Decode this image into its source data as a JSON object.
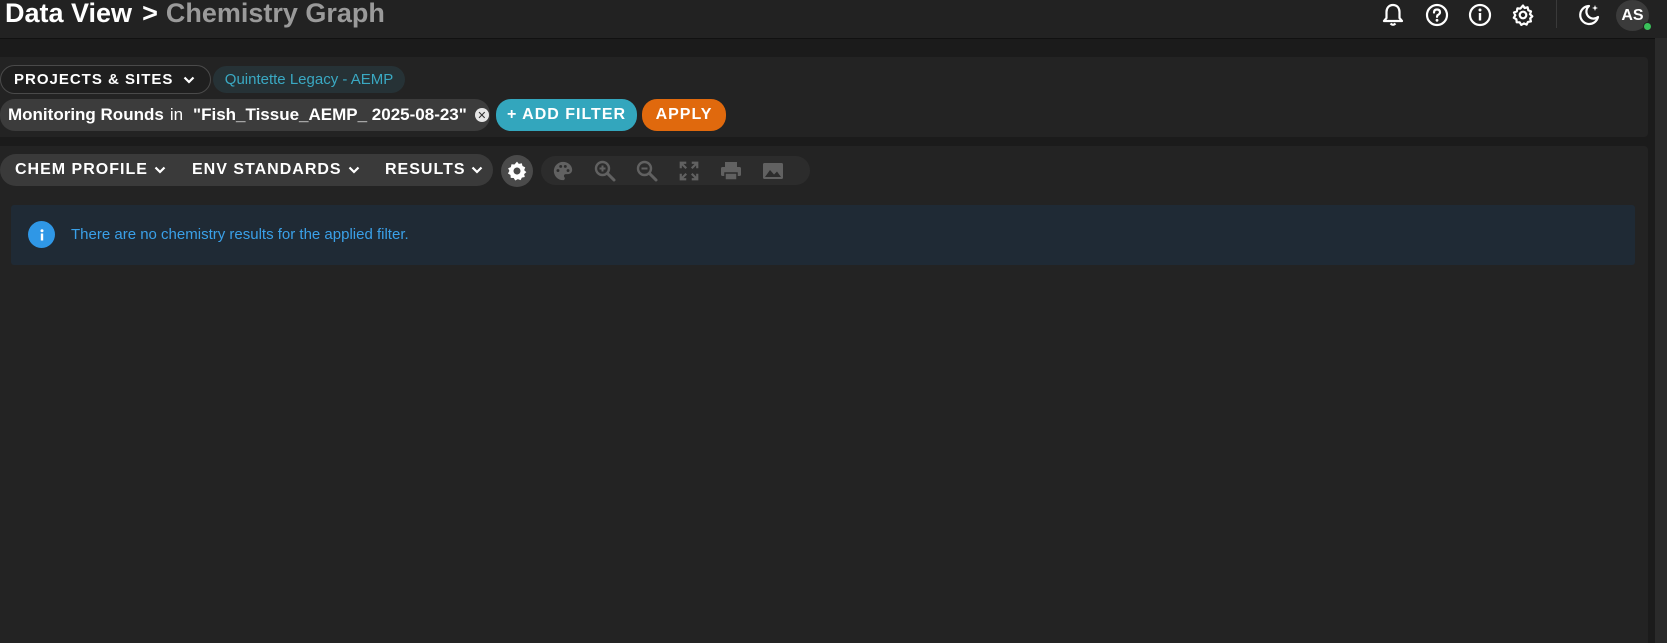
{
  "header": {
    "breadcrumb_root": "Data View",
    "separator": ">",
    "current_page": "Chemistry Graph",
    "icons": [
      "bell-icon",
      "help-circle-icon",
      "info-circle-icon",
      "settings-gear-icon",
      "theme-toggle-icon"
    ],
    "avatar_initials": "AS",
    "presence_color": "#3ac15a"
  },
  "filters": {
    "projects_label": "PROJECTS & SITES",
    "site_chip": "Quintette Legacy - AEMP",
    "active_filter": {
      "field": "Monitoring Rounds",
      "operator": "in",
      "value": "\"Fish_Tissue_AEMP_ 2025-08-23\""
    },
    "add_filter_label": "+ ADD FILTER",
    "apply_label": "APPLY"
  },
  "toolbar": {
    "menus": [
      {
        "label": "CHEM PROFILE"
      },
      {
        "label": "ENV STANDARDS"
      },
      {
        "label": "RESULTS"
      }
    ],
    "tools": [
      "palette-icon",
      "zoom-in-icon",
      "zoom-out-icon",
      "fullscreen-icon",
      "print-icon",
      "image-export-icon"
    ]
  },
  "alert": {
    "message": "There are no chemistry results for the applied filter."
  },
  "colors": {
    "accent_teal": "#33a6bd",
    "accent_orange": "#e0690d",
    "info_blue": "#2f97e6"
  }
}
